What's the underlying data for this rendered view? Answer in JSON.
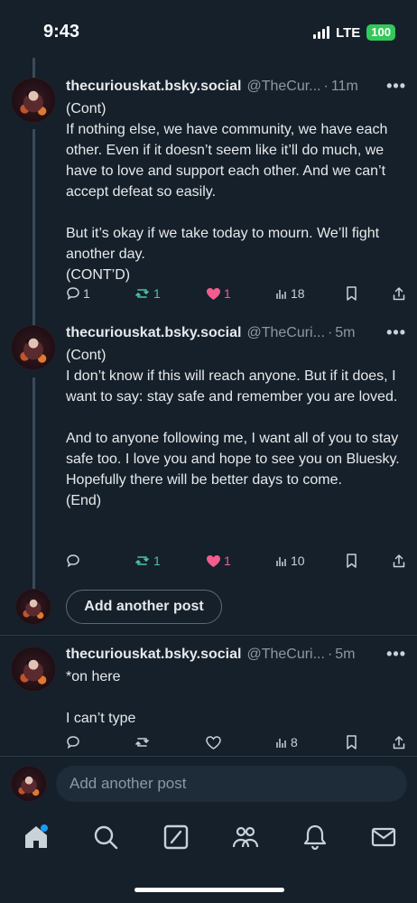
{
  "status": {
    "time": "9:43",
    "network": "LTE",
    "battery": "100"
  },
  "posts": [
    {
      "name": "thecuriouskat.bsky.social",
      "handle": "@TheCur...",
      "time": "11m",
      "text": "(Cont)\nIf nothing else, we have community, we have each other. Even if it doesn’t seem like it’ll do much, we have to love and support each other. And we can’t accept defeat so easily.\n\nBut it’s okay if we take today to mourn. We’ll fight another day.\n(CONT’D)",
      "replies": "1",
      "reposts": "1",
      "likes": "1",
      "views": "18"
    },
    {
      "name": "thecuriouskat.bsky.social",
      "handle": "@TheCuri...",
      "time": "5m",
      "text": "(Cont)\nI don’t know if this will reach anyone. But if it does, I want to say: stay safe and remember you are loved.\n\nAnd to anyone following me, I want all of you to stay safe too. I love you and hope to see you on Bluesky. Hopefully there will be better days to come.\n(End)",
      "replies": "",
      "reposts": "1",
      "likes": "1",
      "views": "10"
    },
    {
      "name": "thecuriouskat.bsky.social",
      "handle": "@TheCuri...",
      "time": "5m",
      "text": "*on here\n\nI can’t type",
      "replies": "",
      "reposts": "",
      "likes": "",
      "views": "8"
    }
  ],
  "add_post_button": "Add another post",
  "compose_placeholder": "Add another post",
  "tabs": [
    "home-icon",
    "search-icon",
    "compose-icon",
    "communities-icon",
    "notifications-icon",
    "messages-icon"
  ],
  "colors": {
    "background": "#15202b",
    "repost": "#4fc3a1",
    "like": "#f25c8f",
    "muted": "#8b98a5",
    "badge": "#1d9bf0"
  }
}
